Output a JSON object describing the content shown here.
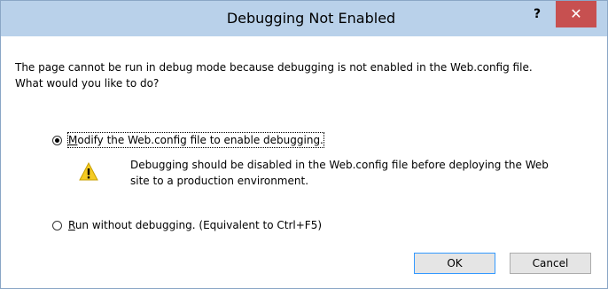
{
  "dialog": {
    "title": "Debugging Not Enabled",
    "help_glyph": "?",
    "close_glyph": "✕",
    "message_line1": "The page cannot be run in debug mode because debugging is not enabled in the Web.config file.",
    "message_line2": "What would you like to do?"
  },
  "options": [
    {
      "accel": "M",
      "rest": "odify the Web.config file to enable debugging.",
      "selected": true
    },
    {
      "accel": "R",
      "rest": "un without debugging. (Equivalent to Ctrl+F5)",
      "selected": false
    }
  ],
  "warning": {
    "line1": "Debugging should be disabled in the Web.config file before deploying the Web",
    "line2": "site to a production environment.",
    "icon": "warning-icon"
  },
  "buttons": {
    "ok_label": "OK",
    "cancel_label": "Cancel"
  },
  "colors": {
    "titlebar": "#b9d1ea",
    "close_button": "#c75050",
    "warning_yellow": "#f5cb23",
    "default_button_border": "#3399ff"
  }
}
